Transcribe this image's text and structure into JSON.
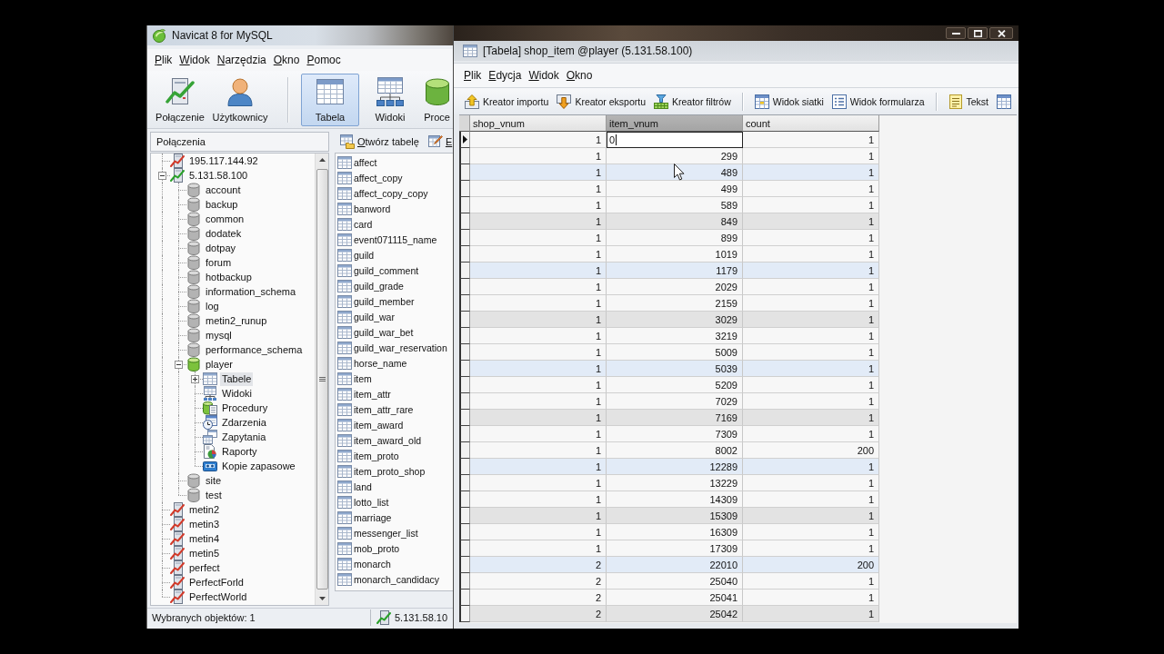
{
  "main_window": {
    "title": "Navicat 8 for MySQL",
    "menu": [
      "Plik",
      "Widok",
      "Narzędzia",
      "Okno",
      "Pomoc"
    ],
    "toolbar_groups": [
      [
        {
          "label": "Połączenie",
          "kind": "connection",
          "selected": false
        },
        {
          "label": "Użytkownicy",
          "kind": "users",
          "selected": false
        }
      ],
      [
        {
          "label": "Tabela",
          "kind": "tables",
          "selected": true
        },
        {
          "label": "Widoki",
          "kind": "views",
          "selected": false
        },
        {
          "label": "Proce",
          "kind": "procedures",
          "selected": false
        }
      ]
    ],
    "connections_panel": {
      "title": "Połączenia",
      "tree": [
        {
          "label": "195.117.144.92",
          "kind": "connection",
          "open": false,
          "selected": false
        },
        {
          "label": "5.131.58.100",
          "kind": "connection",
          "open": true,
          "selected": false,
          "expanded": true,
          "children": [
            {
              "label": "account",
              "kind": "database",
              "open": false,
              "selected": false
            },
            {
              "label": "backup",
              "kind": "database",
              "open": false,
              "selected": false
            },
            {
              "label": "common",
              "kind": "database",
              "open": false,
              "selected": false
            },
            {
              "label": "dodatek",
              "kind": "database",
              "open": false,
              "selected": false
            },
            {
              "label": "dotpay",
              "kind": "database",
              "open": false,
              "selected": false
            },
            {
              "label": "forum",
              "kind": "database",
              "open": false,
              "selected": false
            },
            {
              "label": "hotbackup",
              "kind": "database",
              "open": false,
              "selected": false
            },
            {
              "label": "information_schema",
              "kind": "database",
              "open": false,
              "selected": false
            },
            {
              "label": "log",
              "kind": "database",
              "open": false,
              "selected": false
            },
            {
              "label": "metin2_runup",
              "kind": "database",
              "open": false,
              "selected": false
            },
            {
              "label": "mysql",
              "kind": "database",
              "open": false,
              "selected": false
            },
            {
              "label": "performance_schema",
              "kind": "database",
              "open": false,
              "selected": false
            },
            {
              "label": "player",
              "kind": "database",
              "open": true,
              "selected": false,
              "expanded": true,
              "children": [
                {
                  "label": "Tabele",
                  "kind": "tables",
                  "selected": true,
                  "expanded": false
                },
                {
                  "label": "Widoki",
                  "kind": "views",
                  "selected": false
                },
                {
                  "label": "Procedury",
                  "kind": "procedures",
                  "selected": false
                },
                {
                  "label": "Zdarzenia",
                  "kind": "events",
                  "selected": false
                },
                {
                  "label": "Zapytania",
                  "kind": "queries",
                  "selected": false
                },
                {
                  "label": "Raporty",
                  "kind": "reports",
                  "selected": false
                },
                {
                  "label": "Kopie zapasowe",
                  "kind": "backups",
                  "selected": false
                }
              ]
            },
            {
              "label": "site",
              "kind": "database",
              "open": false,
              "selected": false
            },
            {
              "label": "test",
              "kind": "database",
              "open": false,
              "selected": false
            }
          ]
        },
        {
          "label": "metin2",
          "kind": "connection",
          "open": false,
          "selected": false
        },
        {
          "label": "metin3",
          "kind": "connection",
          "open": false,
          "selected": false
        },
        {
          "label": "metin4",
          "kind": "connection",
          "open": false,
          "selected": false
        },
        {
          "label": "metin5",
          "kind": "connection",
          "open": false,
          "selected": false
        },
        {
          "label": "perfect",
          "kind": "connection",
          "open": false,
          "selected": false
        },
        {
          "label": "PerfectForld",
          "kind": "connection",
          "open": false,
          "selected": false
        },
        {
          "label": "PerfectWorld",
          "kind": "connection",
          "open": false,
          "selected": false
        }
      ]
    },
    "objects_panel": {
      "toolbar": [
        {
          "label": "Otwórz tabelę",
          "kind": "open"
        },
        {
          "label": "E",
          "kind": "edit"
        }
      ],
      "items": [
        "affect",
        "affect_copy",
        "affect_copy_copy",
        "banword",
        "card",
        "event071115_name",
        "guild",
        "guild_comment",
        "guild_grade",
        "guild_member",
        "guild_war",
        "guild_war_bet",
        "guild_war_reservation",
        "horse_name",
        "item",
        "item_attr",
        "item_attr_rare",
        "item_award",
        "item_award_old",
        "item_proto",
        "item_proto_shop",
        "land",
        "lotto_list",
        "marriage",
        "messenger_list",
        "mob_proto",
        "monarch",
        "monarch_candidacy"
      ]
    },
    "status_bar": {
      "selection": "Wybranych objektów: 1",
      "connection": "5.131.58.10"
    }
  },
  "table_window": {
    "title": "[Tabela] shop_item @player (5.131.58.100)",
    "menu": [
      "Plik",
      "Edycja",
      "Widok",
      "Okno"
    ],
    "toolbar_groups": [
      [
        {
          "label": "Kreator importu",
          "kind": "import"
        },
        {
          "label": "Kreator eksportu",
          "kind": "export"
        },
        {
          "label": "Kreator filtrów",
          "kind": "filter"
        }
      ],
      [
        {
          "label": "Widok siatki",
          "kind": "grid"
        },
        {
          "label": "Widok formularza",
          "kind": "form"
        }
      ],
      [
        {
          "label": "Tekst",
          "kind": "text"
        },
        {
          "kind": "table"
        }
      ]
    ],
    "grid": {
      "columns": [
        {
          "label": "shop_vnum",
          "selected": false
        },
        {
          "label": "item_vnum",
          "selected": true
        },
        {
          "label": "count",
          "selected": false
        }
      ],
      "rows": [
        {
          "selected": true,
          "color": "#f7f7f7",
          "cells": [
            "1",
            "0",
            "1"
          ]
        },
        {
          "selected": false,
          "color": "#f7f7f7",
          "cells": [
            "1",
            "299",
            "1"
          ]
        },
        {
          "selected": false,
          "color": "#e2ebf7",
          "cells": [
            "1",
            "489",
            "1"
          ]
        },
        {
          "selected": false,
          "color": "#f7f7f7",
          "cells": [
            "1",
            "499",
            "1"
          ]
        },
        {
          "selected": false,
          "color": "#f7f7f7",
          "cells": [
            "1",
            "589",
            "1"
          ]
        },
        {
          "selected": false,
          "color": "#e3e3e3",
          "cells": [
            "1",
            "849",
            "1"
          ]
        },
        {
          "selected": false,
          "color": "#f7f7f7",
          "cells": [
            "1",
            "899",
            "1"
          ]
        },
        {
          "selected": false,
          "color": "#f7f7f7",
          "cells": [
            "1",
            "1019",
            "1"
          ]
        },
        {
          "selected": false,
          "color": "#e2ebf7",
          "cells": [
            "1",
            "1179",
            "1"
          ]
        },
        {
          "selected": false,
          "color": "#f7f7f7",
          "cells": [
            "1",
            "2029",
            "1"
          ]
        },
        {
          "selected": false,
          "color": "#f7f7f7",
          "cells": [
            "1",
            "2159",
            "1"
          ]
        },
        {
          "selected": false,
          "color": "#e3e3e3",
          "cells": [
            "1",
            "3029",
            "1"
          ]
        },
        {
          "selected": false,
          "color": "#f7f7f7",
          "cells": [
            "1",
            "3219",
            "1"
          ]
        },
        {
          "selected": false,
          "color": "#f7f7f7",
          "cells": [
            "1",
            "5009",
            "1"
          ]
        },
        {
          "selected": false,
          "color": "#e2ebf7",
          "cells": [
            "1",
            "5039",
            "1"
          ]
        },
        {
          "selected": false,
          "color": "#f7f7f7",
          "cells": [
            "1",
            "5209",
            "1"
          ]
        },
        {
          "selected": false,
          "color": "#f7f7f7",
          "cells": [
            "1",
            "7029",
            "1"
          ]
        },
        {
          "selected": false,
          "color": "#e3e3e3",
          "cells": [
            "1",
            "7169",
            "1"
          ]
        },
        {
          "selected": false,
          "color": "#f7f7f7",
          "cells": [
            "1",
            "7309",
            "1"
          ]
        },
        {
          "selected": false,
          "color": "#f7f7f7",
          "cells": [
            "1",
            "8002",
            "200"
          ]
        },
        {
          "selected": false,
          "color": "#e2ebf7",
          "cells": [
            "1",
            "12289",
            "1"
          ]
        },
        {
          "selected": false,
          "color": "#f7f7f7",
          "cells": [
            "1",
            "13229",
            "1"
          ]
        },
        {
          "selected": false,
          "color": "#f7f7f7",
          "cells": [
            "1",
            "14309",
            "1"
          ]
        },
        {
          "selected": false,
          "color": "#e3e3e3",
          "cells": [
            "1",
            "15309",
            "1"
          ]
        },
        {
          "selected": false,
          "color": "#f7f7f7",
          "cells": [
            "1",
            "16309",
            "1"
          ]
        },
        {
          "selected": false,
          "color": "#f7f7f7",
          "cells": [
            "1",
            "17309",
            "1"
          ]
        },
        {
          "selected": false,
          "color": "#e2ebf7",
          "cells": [
            "2",
            "22010",
            "200"
          ]
        },
        {
          "selected": false,
          "color": "#f7f7f7",
          "cells": [
            "2",
            "25040",
            "1"
          ]
        },
        {
          "selected": false,
          "color": "#f7f7f7",
          "cells": [
            "2",
            "25041",
            "1"
          ]
        },
        {
          "selected": false,
          "color": "#e3e3e3",
          "cells": [
            "2",
            "25042",
            "1"
          ]
        }
      ]
    }
  }
}
